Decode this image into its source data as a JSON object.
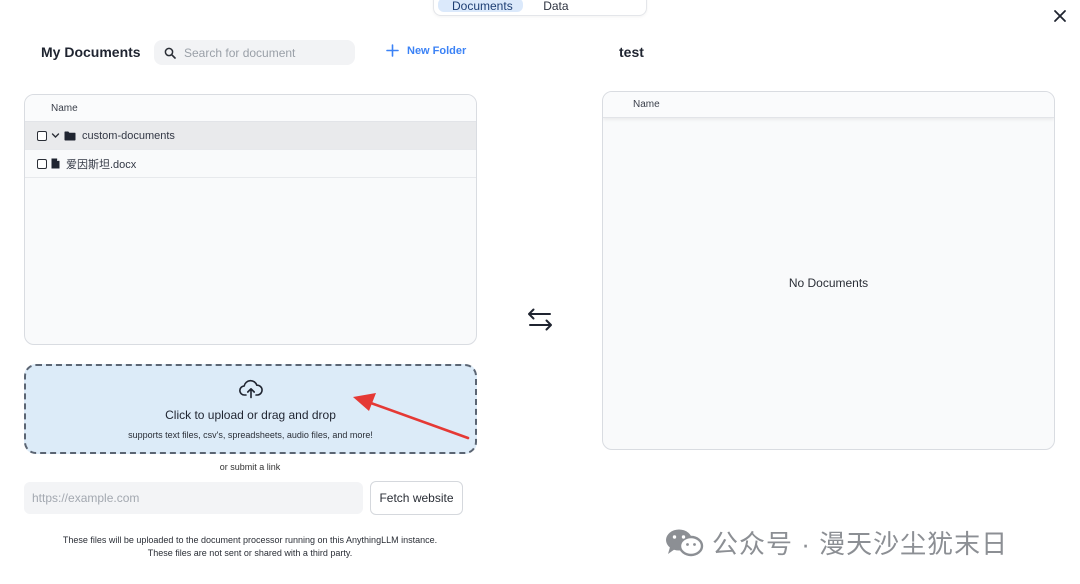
{
  "tabs": [
    {
      "label": "Documents",
      "active": true
    },
    {
      "label": "Data Connectors",
      "active": false
    }
  ],
  "left": {
    "title": "My Documents",
    "search_placeholder": "Search for document",
    "new_folder_label": "New Folder",
    "column_name": "Name",
    "items": [
      {
        "type": "folder",
        "name": "custom-documents",
        "expanded": true,
        "selected": true
      },
      {
        "type": "file",
        "name": "爱因斯坦.docx",
        "selected": false
      }
    ]
  },
  "right": {
    "title": "test",
    "column_name": "Name",
    "empty_text": "No Documents"
  },
  "upload": {
    "title": "Click to upload or drag and drop",
    "subtitle": "supports text files, csv's, spreadsheets, audio files, and more!",
    "or_link": "or submit a link",
    "url_placeholder": "https://example.com",
    "fetch_label": "Fetch website",
    "notice_line1": "These files will be uploaded to the document processor running on this AnythingLLM instance.",
    "notice_line2": "These files are not sent or shared with a third party."
  },
  "watermark": "公众号 · 漫天沙尘犹末日",
  "colors": {
    "accent": "#3b82f6",
    "dropzone_bg": "#dcebf8",
    "tab_active_bg": "#dbe9fb",
    "annotation_arrow": "#e53935"
  },
  "icons": {
    "close": "close-icon",
    "search": "search-icon",
    "plus": "plus-icon",
    "swap": "swap-arrows-icon",
    "upload": "cloud-upload-icon",
    "folder": "folder-icon",
    "file": "file-icon"
  }
}
